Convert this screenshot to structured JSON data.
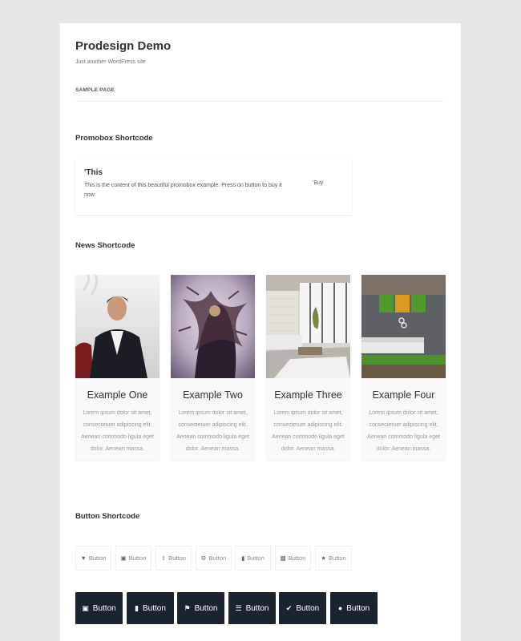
{
  "site": {
    "title": "Prodesign Demo",
    "description": "Just another WordPress site"
  },
  "nav": {
    "items": [
      "SAMPLE PAGE"
    ]
  },
  "sections": {
    "promobox": "Promobox Shortcode",
    "news": "News Shortcode",
    "button": "Button Shortcode"
  },
  "promobox": {
    "title": "'This",
    "text": "This is the content of this beautiful promobox example. Press on button to buy it now.",
    "button": "'Buy"
  },
  "news": [
    {
      "title": "Example One",
      "text": "Lorem ipsum dolor sit amet, consectetuer adipiscing elit. Aenean commodo ligula eget dolor. Aenean massa."
    },
    {
      "title": "Example Two",
      "text": "Lorem ipsum dolor sit amet, consectetuer adipiscing elit. Aenean commodo ligula eget dolor. Aenean massa."
    },
    {
      "title": "Example Three",
      "text": "Lorem ipsum dolor sit amet, consectetuer adipiscing elit. Aenean commodo ligula eget dolor. Aenean massa."
    },
    {
      "title": "Example Four",
      "text": "Lorem ipsum dolor sit amet, consectetuer adipiscing elit. Aenean commodo ligula eget dolor. Aenean massa."
    }
  ],
  "buttons_light": [
    {
      "label": "Button",
      "icon": "filter-icon"
    },
    {
      "label": "Button",
      "icon": "camera-icon"
    },
    {
      "label": "Button",
      "icon": "upload-icon"
    },
    {
      "label": "Button",
      "icon": "gear-icon"
    },
    {
      "label": "Button",
      "icon": "signal-icon"
    },
    {
      "label": "Button",
      "icon": "briefcase-icon"
    },
    {
      "label": "Button",
      "icon": "trophy-icon"
    }
  ],
  "buttons_dark": [
    {
      "label": "Button",
      "icon": "desktop-icon"
    },
    {
      "label": "Button",
      "icon": "signal-icon"
    },
    {
      "label": "Button",
      "icon": "flag-icon"
    },
    {
      "label": "Button",
      "icon": "list-icon"
    },
    {
      "label": "Button",
      "icon": "check-icon"
    },
    {
      "label": "Button",
      "icon": "comments-icon"
    }
  ],
  "colors": {
    "page_bg": "#e6e6e6",
    "content_bg": "#ffffff",
    "dark_button": "#1a2430",
    "accent_link": "#4a6a8a"
  }
}
